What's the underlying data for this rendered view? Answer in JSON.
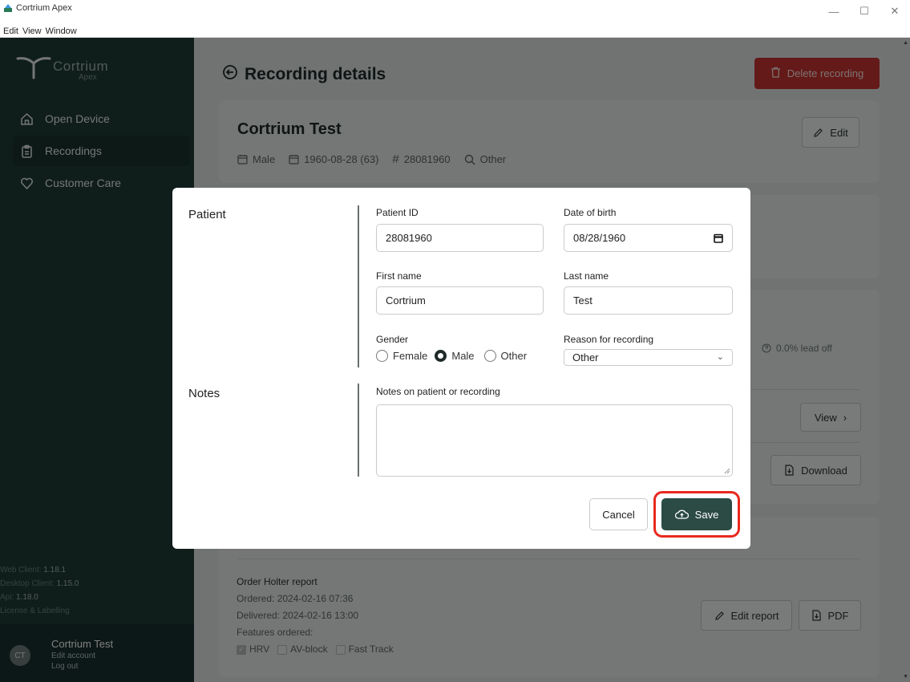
{
  "window": {
    "title": "Cortrium Apex",
    "minimize": "—",
    "maximize": "☐",
    "close": "✕"
  },
  "menu": [
    "Edit",
    "View",
    "Window"
  ],
  "sidebar": {
    "brand": "Cortrium",
    "brand_sub": "Apex",
    "items": [
      {
        "label": "Open Device",
        "icon": "home-icon"
      },
      {
        "label": "Recordings",
        "icon": "clipboard-icon",
        "active": true
      },
      {
        "label": "Customer Care",
        "icon": "heart-icon"
      }
    ],
    "versions": {
      "web_label": "Web Client:",
      "web": "1.18.1",
      "desktop_label": "Desktop Client:",
      "desktop": "1.15.0",
      "api_label": "Api:",
      "api": "1.18.0",
      "license": "License & Labelling"
    },
    "user": {
      "initials": "CT",
      "name": "Cortrium Test",
      "edit": "Edit account",
      "logout": "Log out"
    }
  },
  "page": {
    "title": "Recording details",
    "delete_button": "Delete recording",
    "patient_card": {
      "name": "Cortrium Test",
      "gender": "Male",
      "dob": "1960-08-28 (63)",
      "id": "28081960",
      "reason": "Other",
      "edit_button": "Edit"
    },
    "lead_off": "0.0% lead off",
    "view_button": "View",
    "download_button": "Download",
    "report": {
      "title": "Order Holter report",
      "ordered": "Ordered: 2024-02-16 07:36",
      "delivered": "Delivered: 2024-02-16 13:00",
      "features_label": "Features ordered:",
      "features": [
        {
          "label": "HRV",
          "checked": true
        },
        {
          "label": "AV-block",
          "checked": false
        },
        {
          "label": "Fast Track",
          "checked": false
        }
      ],
      "edit_report_button": "Edit report",
      "pdf_button": "PDF"
    }
  },
  "modal": {
    "patient_section": "Patient",
    "notes_section": "Notes",
    "patient_id_label": "Patient ID",
    "patient_id_value": "28081960",
    "dob_label": "Date of birth",
    "dob_value": "08/28/1960",
    "first_name_label": "First name",
    "first_name_value": "Cortrium",
    "last_name_label": "Last name",
    "last_name_value": "Test",
    "gender_label": "Gender",
    "gender_options": [
      "Female",
      "Male",
      "Other"
    ],
    "gender_selected": "Male",
    "reason_label": "Reason for recording",
    "reason_value": "Other",
    "notes_label": "Notes on patient or recording",
    "notes_value": "",
    "cancel_button": "Cancel",
    "save_button": "Save"
  },
  "colors": {
    "sidebar": "#1f3b37",
    "accent": "#2c4b45",
    "danger": "#c93530",
    "highlight": "#e8291e"
  }
}
